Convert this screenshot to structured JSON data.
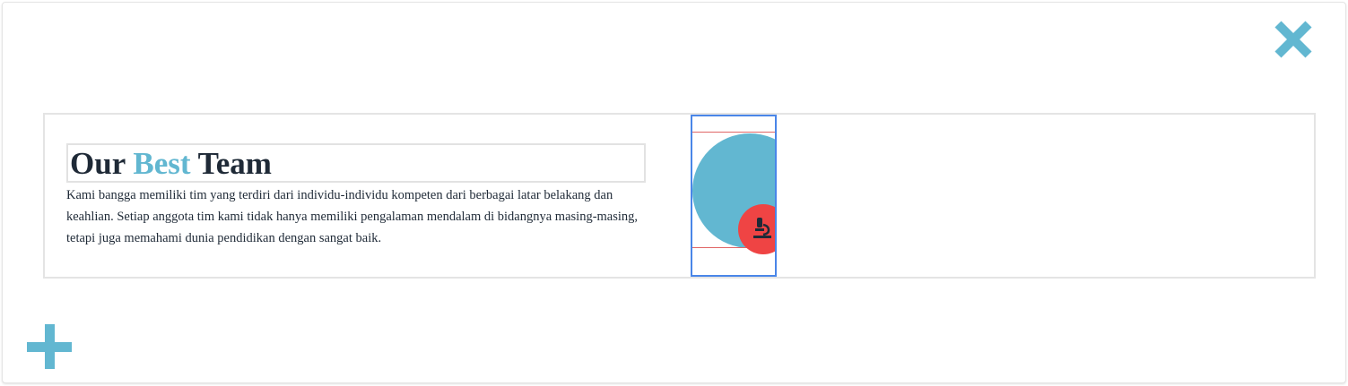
{
  "heading": {
    "prefix": "Our",
    "accent": "Best",
    "suffix": "Team"
  },
  "description": "Kami bangga memiliki tim yang terdiri dari individu-individu kompeten dari berbagai latar belakang dan keahlian. Setiap anggota tim kami tidak hanya memiliki pengalaman mendalam di bidangnya masing-masing, tetapi juga memahami dunia pendidikan dengan sangat baik.",
  "icons": {
    "close": "close-icon",
    "add": "plus-icon",
    "feature": "microscope-icon"
  },
  "colors": {
    "accent": "#62b7d1",
    "heading_text": "#1f2a37",
    "badge": "#ef4444",
    "selection_border": "#4a86e8",
    "guide_line": "#e06666"
  }
}
